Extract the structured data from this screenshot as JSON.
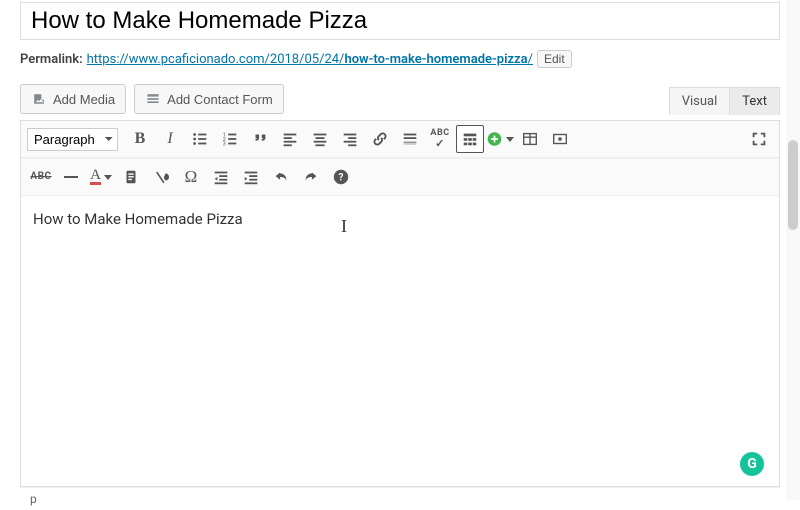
{
  "title": "How to Make Homemade Pizza",
  "permalink": {
    "label": "Permalink:",
    "base": "https://www.pcaficionado.com/2018/05/24/",
    "slug": "how-to-make-homemade-pizza",
    "trail": "/",
    "edit_label": "Edit"
  },
  "buttons": {
    "add_media": "Add Media",
    "add_contact_form": "Add Contact Form"
  },
  "tabs": {
    "visual": "Visual",
    "text": "Text"
  },
  "format_selector": "Paragraph",
  "toolbar_row1": [
    "bold",
    "italic",
    "bullet-list",
    "number-list",
    "blockquote",
    "align-left",
    "align-center",
    "align-right",
    "link",
    "insert-more",
    "spellcheck",
    "toggle-toolbar",
    "add-block",
    "insert-table",
    "distraction-free"
  ],
  "toolbar_row2": [
    "strikethrough",
    "horizontal-rule",
    "text-color",
    "paste-text",
    "clear-format",
    "special-char",
    "outdent",
    "indent",
    "undo",
    "redo",
    "help"
  ],
  "editor_text": "How to Make Homemade Pizza",
  "status_path": "p",
  "grammarly": "G",
  "colors": {
    "link": "#0073aa",
    "green": "#46b450",
    "grammarly": "#15c39a"
  }
}
